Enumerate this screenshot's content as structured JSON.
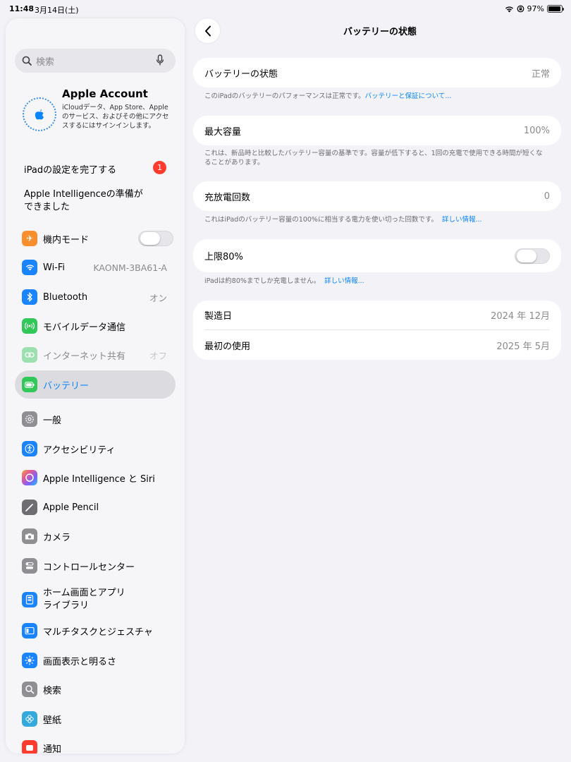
{
  "status": {
    "time": "11:48",
    "date": "3月14日(土)",
    "battery": "97%",
    "battery_level": 0.97
  },
  "sidebar": {
    "search_placeholder": "検索",
    "account": {
      "title": "Apple Account",
      "desc": "iCloudデータ、App Store、Appleのサービス、およびその他にアクセスするにはサインインします。"
    },
    "setup": {
      "label": "iPadの設定を完了する",
      "badge": "1"
    },
    "intelligence_ready": {
      "line1": "Apple Intelligenceの準備が",
      "line2": "できました"
    },
    "items": [
      {
        "label": "機内モード",
        "icon": "airplane-icon",
        "color": "#f7902c"
      },
      {
        "label": "Wi-Fi",
        "value": "KAONM-3BA61-A",
        "icon": "wifi-icon",
        "color": "#1a84ff"
      },
      {
        "label": "Bluetooth",
        "value": "オン",
        "icon": "bluetooth-icon",
        "color": "#1a84ff"
      },
      {
        "label": "モバイルデータ通信",
        "icon": "cellular-icon",
        "color": "#32c759"
      },
      {
        "label": "インターネット共有",
        "value": "オフ",
        "icon": "hotspot-icon",
        "color": "#32c759"
      },
      {
        "label": "バッテリー",
        "icon": "battery-icon",
        "color": "#32c759"
      },
      {
        "label": "一般",
        "icon": "gear-icon",
        "color": "#8e8e93"
      },
      {
        "label": "アクセシビリティ",
        "icon": "accessibility-icon",
        "color": "#1a84ff"
      },
      {
        "label": "Apple Intelligence と Siri",
        "icon": "siri-icon",
        "color": "#e0569a"
      },
      {
        "label": "Apple Pencil",
        "icon": "pencil-icon",
        "color": "#6d6d72"
      },
      {
        "label": "カメラ",
        "icon": "camera-icon",
        "color": "#8e8e93"
      },
      {
        "label": "コントロールセンター",
        "icon": "control-center-icon",
        "color": "#8e8e93"
      },
      {
        "label": "ホーム画面とアプリ",
        "label2": "ライブラリ",
        "icon": "home-screen-icon",
        "color": "#1a84ff"
      },
      {
        "label": "マルチタスクとジェスチャ",
        "icon": "multitask-icon",
        "color": "#1a84ff"
      },
      {
        "label": "画面表示と明るさ",
        "icon": "brightness-icon",
        "color": "#1a84ff"
      },
      {
        "label": "検索",
        "icon": "search-icon",
        "color": "#8e8e93"
      },
      {
        "label": "壁紙",
        "icon": "wallpaper-icon",
        "color": "#34aadc"
      },
      {
        "label": "通知",
        "icon": "notification-icon",
        "color": "#ff3b30"
      }
    ]
  },
  "main": {
    "title": "バッテリーの状態",
    "health": {
      "label": "バッテリーの状態",
      "value": "正常",
      "foot": "このiPadのバッテリーのパフォーマンスは正常です。",
      "link": "バッテリーと保証について..."
    },
    "capacity": {
      "label": "最大容量",
      "value": "100%",
      "foot": "これは、新品時と比較したバッテリー容量の基準です。容量が低下すると、1回の充電で使用できる時間が短くなることがあります。"
    },
    "cycles": {
      "label": "充放電回数",
      "value": "0",
      "foot": "これはiPadのバッテリー容量の100%に相当する電力を使い切った回数です。",
      "link": "詳しい情報..."
    },
    "limit": {
      "label": "上限80%",
      "foot": "iPadは約80%までしか充電しません。",
      "link": "詳しい情報..."
    },
    "manufacture": {
      "label": "製造日",
      "value": "2024 年 12月"
    },
    "first_use": {
      "label": "最初の使用",
      "value": "2025 年 5月"
    }
  }
}
